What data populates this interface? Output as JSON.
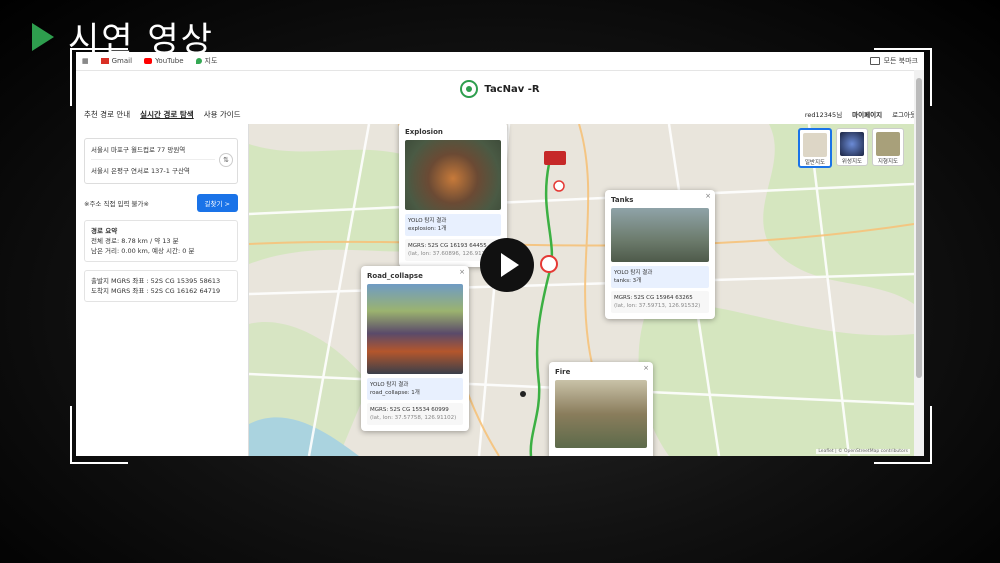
{
  "slide": {
    "title": "시연 영상"
  },
  "bookmarks": {
    "items": [
      {
        "label": "Gmail",
        "color": "#d93025"
      },
      {
        "label": "YouTube",
        "color": "#ff0000"
      },
      {
        "label": "지도",
        "color": "#34a853"
      }
    ],
    "all_bookmarks": "모든 북마크"
  },
  "app": {
    "title": "TacNav -R",
    "nav": [
      "추천 경로 안내",
      "실시간 경로 탐색",
      "사용 가이드"
    ],
    "user": "red12345님",
    "mypage": "마이페이지",
    "logout": "로그아웃"
  },
  "sidebar": {
    "origin": "서울시 마포구 월드컵로 77 망원역",
    "destination": "서울시 은평구 연서로 137-1 구산역",
    "hint": "※주소 직접 입력 불가※",
    "find_button": "길찾기 >",
    "summary": {
      "heading": "경로 요약",
      "total": "전체 경로: 8.78 km / 약 13 분",
      "remaining": "남은 거리: 0.00 km, 예상 시간: 0 분"
    },
    "mgrs": {
      "start": "출발지 MGRS 좌표 : 52S CG 15395 58613",
      "end": "도착지 MGRS 좌표 : 52S CG 16162 64719"
    },
    "collapse_icon": "◀"
  },
  "map": {
    "layers": [
      "일반지도",
      "위성지도",
      "지형지도"
    ],
    "attribution": "Leaflet | © OpenStreetMap contributors",
    "route_color": "#3cb043"
  },
  "popups": {
    "explosion": {
      "title": "Explosion",
      "yolo_label": "YOLO 탐지 결과",
      "detection": "explosion: 1개",
      "mgrs": "MGRS: 52S CG 16193 64455",
      "latlon": "(lat, lon: 37.60896, 126.91748)"
    },
    "tanks": {
      "title": "Tanks",
      "yolo_label": "YOLO 탐지 결과",
      "detection": "tanks: 3개",
      "mgrs": "MGRS: 52S CG 15964 63265",
      "latlon": "(lat, lon: 37.59713, 126.91532)"
    },
    "road_collapse": {
      "title": "Road_collapse",
      "yolo_label": "YOLO 탐지 결과",
      "detection": "road_collapse: 1개",
      "mgrs": "MGRS: 52S CG 15534 60999",
      "latlon": "(lat, lon: 37.57758, 126.91102)"
    },
    "fire": {
      "title": "Fire"
    }
  },
  "video": {
    "play_icon": "play-icon"
  }
}
